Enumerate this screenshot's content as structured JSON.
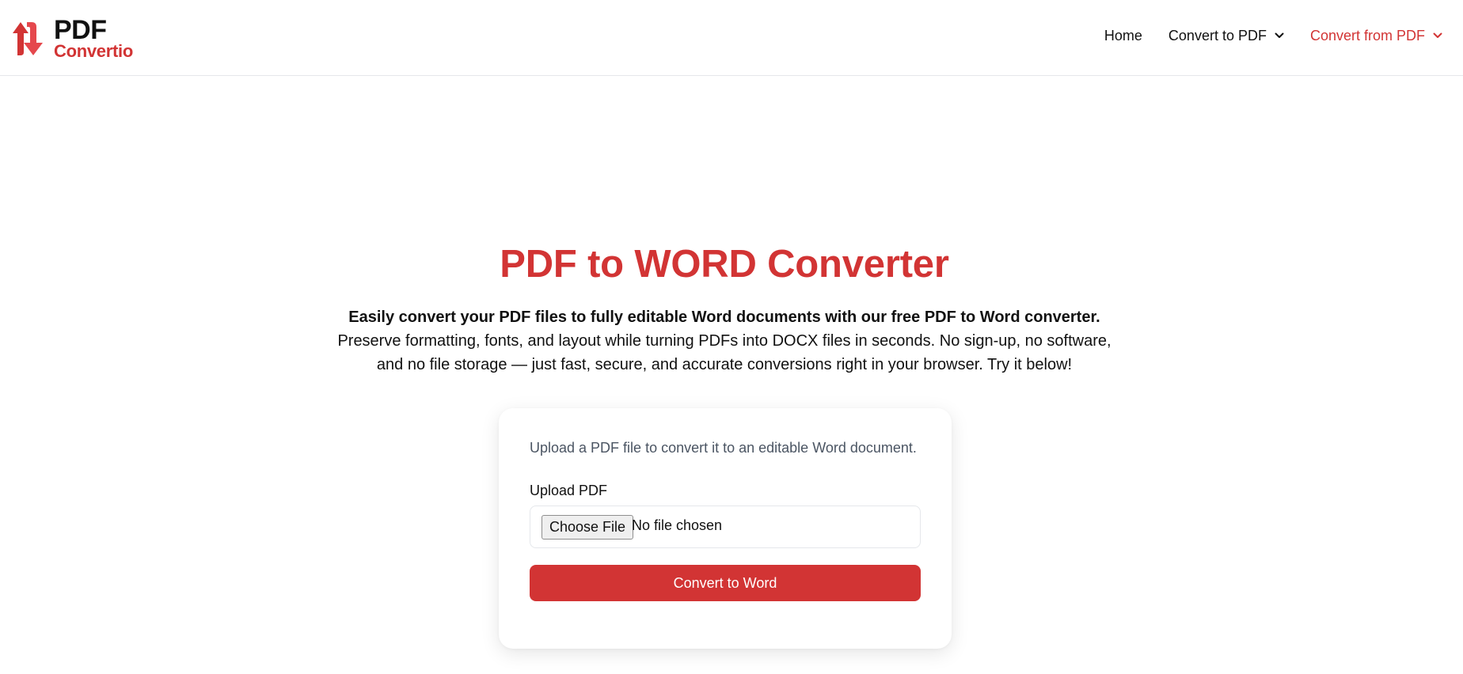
{
  "brand": {
    "name_top": "PDF",
    "name_bottom": "Convertio",
    "color": "#d23434"
  },
  "nav": {
    "items": [
      {
        "label": "Home",
        "has_dropdown": false,
        "active": false
      },
      {
        "label": "Convert to PDF",
        "has_dropdown": true,
        "active": false
      },
      {
        "label": "Convert from PDF",
        "has_dropdown": true,
        "active": true
      }
    ]
  },
  "main": {
    "title": "PDF to WORD Converter",
    "intro_bold": "Easily convert your PDF files to fully editable Word documents with our free PDF to Word converter.",
    "intro_rest": " Preserve formatting, fonts, and layout while turning PDFs into DOCX files in seconds. No sign-up, no software, and no file storage — just fast, secure, and accurate conversions right in your browser. Try it below!"
  },
  "converter": {
    "description": "Upload a PDF file to convert it to an editable Word document.",
    "upload_label": "Upload PDF",
    "file_button_label": "Choose File",
    "file_status": "No file chosen",
    "submit_label": "Convert to Word"
  },
  "icons": {
    "logo": "pdf-arrows-icon",
    "dropdown": "chevron-down-icon"
  }
}
